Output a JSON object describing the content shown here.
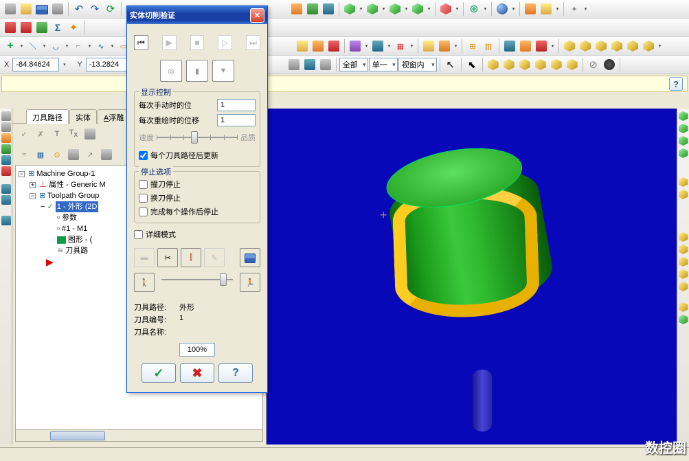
{
  "coords": {
    "x_label": "X",
    "x_value": "-84.84624",
    "y_label": "Y",
    "y_value": "-13.2824"
  },
  "combos": {
    "all": "全部",
    "single": "单一",
    "viewport": "视窗内"
  },
  "tree": {
    "tabs": {
      "toolpath": "刀具路径",
      "solid": "实体",
      "relief": "A浮雕"
    },
    "root": "Machine Group-1",
    "n1": "属性 - Generic M",
    "n2": "Toolpath Group",
    "n3": "1 - 外形 (2D",
    "n4": "参数",
    "n5": "#1 - M1",
    "n6": "图形 - (",
    "n7": "刀具路"
  },
  "dialog": {
    "title": "实体切削验证",
    "display_ctrl": "显示控制",
    "manual_label": "每次手动时的位",
    "manual_val": "1",
    "redraw_label": "每次重绘时的位移",
    "redraw_val": "1",
    "speed": "速度",
    "quality": "品质",
    "update_each": "每个刀具路径后更新",
    "stop_opts": "停止选项",
    "collide_stop": "撞刀停止",
    "tool_change_stop": "换刀停止",
    "after_op_stop": "完成每个操作后停止",
    "verbose": "详细模式",
    "tp_path_lbl": "刀具路径:",
    "tp_path_val": "外形",
    "tp_num_lbl": "刀具编号:",
    "tp_num_val": "1",
    "tp_name_lbl": "刀具名称:",
    "tp_name_val": "",
    "progress": "100%"
  },
  "watermark": "数控圈"
}
